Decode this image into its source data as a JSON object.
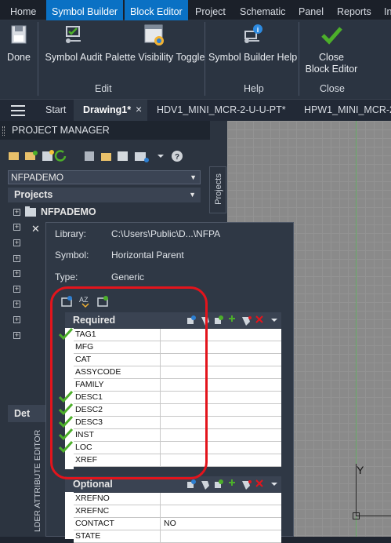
{
  "ribbon_tabs": [
    "Home",
    "Symbol Builder",
    "Block Editor",
    "Project",
    "Schematic",
    "Panel",
    "Reports",
    "In"
  ],
  "ribbon": {
    "buttons": {
      "done": "Done",
      "audit": "Symbol Audit",
      "palette": "Palette Visibility Toggle",
      "help": "Symbol Builder Help",
      "close1": "Close",
      "close2": "Block Editor"
    },
    "groups": {
      "edit": "Edit",
      "help": "Help",
      "close": "Close"
    }
  },
  "doc_tabs": {
    "start": "Start",
    "drawing": "Drawing1*",
    "close": "×",
    "hdv": "HDV1_MINI_MCR-2-U-U-PT*",
    "hpw": "HPW1_MINI_MCR-2-"
  },
  "project_manager": {
    "title": "PROJECT MANAGER",
    "side_tab": "Projects",
    "combo_value": "NFPADEMO",
    "projects_header": "Projects",
    "root_item": "NFPADEMO",
    "details_header": "Det"
  },
  "popup": {
    "library_label": "Library:",
    "library_value": "C:\\Users\\Public\\D...\\NFPA",
    "symbol_label": "Symbol:",
    "symbol_value": "Horizontal Parent",
    "type_label": "Type:",
    "type_value": "Generic",
    "required_header": "Required",
    "required_rows": [
      {
        "name": "TAG1",
        "value": "",
        "check": true
      },
      {
        "name": "MFG",
        "value": "",
        "check": false
      },
      {
        "name": "CAT",
        "value": "",
        "check": false
      },
      {
        "name": "ASSYCODE",
        "value": "",
        "check": false
      },
      {
        "name": "FAMILY",
        "value": "",
        "check": false
      },
      {
        "name": "DESC1",
        "value": "",
        "check": true
      },
      {
        "name": "DESC2",
        "value": "",
        "check": true
      },
      {
        "name": "DESC3",
        "value": "",
        "check": true
      },
      {
        "name": "INST",
        "value": "",
        "check": true
      },
      {
        "name": "LOC",
        "value": "",
        "check": true
      },
      {
        "name": "XREF",
        "value": "",
        "check": false
      }
    ],
    "optional_header": "Optional",
    "optional_rows": [
      {
        "name": "XREFNO",
        "value": ""
      },
      {
        "name": "XREFNC",
        "value": ""
      },
      {
        "name": "CONTACT",
        "value": "NO"
      },
      {
        "name": "STATE",
        "value": ""
      }
    ],
    "side_label": "LDER ATTRIBUTE EDITOR"
  },
  "canvas": {
    "axis_label": "Y"
  },
  "colors": {
    "accent": "#0a71c4",
    "check": "#4caf2a",
    "highlight_ring": "#e3141c"
  }
}
